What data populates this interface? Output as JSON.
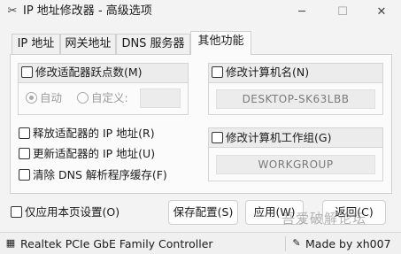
{
  "window": {
    "title": "IP 地址修改器 - 高级选项",
    "minimize": "─",
    "maximize": "☐",
    "close": "✕"
  },
  "tabs": [
    {
      "label": "IP 地址",
      "active": false
    },
    {
      "label": "网关地址",
      "active": false
    },
    {
      "label": "DNS 服务器",
      "active": false
    },
    {
      "label": "其他功能",
      "active": true
    }
  ],
  "hops": {
    "label": "修改适配器跃点数(M)",
    "auto_label": "自动",
    "custom_label": "自定义:",
    "custom_value": ""
  },
  "computer_name": {
    "label": "修改计算机名(N)",
    "value": "DESKTOP-SK63LBB"
  },
  "workgroup": {
    "label": "修改计算机工作组(G)",
    "value": "WORKGROUP"
  },
  "options": {
    "release_ip": "释放适配器的 IP 地址(R)",
    "renew_ip": "更新适配器的 IP 地址(U)",
    "flush_dns": "清除 DNS 解析程序缓存(F)"
  },
  "footer": {
    "apply_page_only": "仅应用本页设置(O)",
    "save_config": "保存配置(S)",
    "apply": "应用(W)",
    "back": "返回(C)"
  },
  "status": {
    "adapter": "Realtek PCIe GbE Family Controller",
    "author": "Made by xh007"
  },
  "watermark": "吾爱破解论坛",
  "colors": {
    "background": "#f3f3f3",
    "panel": "#fbfbfb",
    "disabled_text": "#9a9a9a"
  }
}
